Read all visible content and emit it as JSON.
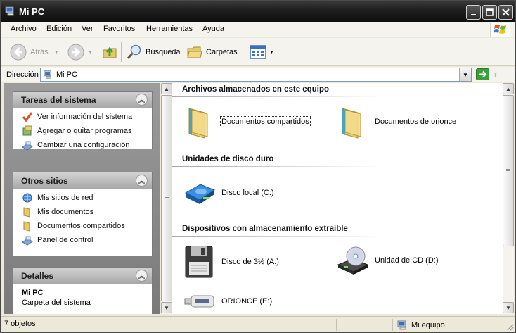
{
  "window": {
    "title": "Mi PC"
  },
  "menu": [
    "Archivo",
    "Edición",
    "Ver",
    "Favoritos",
    "Herramientas",
    "Ayuda"
  ],
  "toolbar": {
    "back": "Atrás",
    "search": "Búsqueda",
    "folders": "Carpetas"
  },
  "address": {
    "label": "Dirección",
    "value": "Mi PC",
    "go": "Ir"
  },
  "sidebar": {
    "tasks_title": "Tareas del sistema",
    "tasks": [
      {
        "label": "Ver información del sistema",
        "icon": "checkmark-icon"
      },
      {
        "label": "Agregar o quitar programas",
        "icon": "install-programs-icon"
      },
      {
        "label": "Cambiar una configuración",
        "icon": "control-panel-icon"
      }
    ],
    "places_title": "Otros sitios",
    "places": [
      {
        "label": "Mis sitios de red",
        "icon": "network-icon"
      },
      {
        "label": "Mis documentos",
        "icon": "folder-icon"
      },
      {
        "label": "Documentos compartidos",
        "icon": "folder-icon"
      },
      {
        "label": "Panel de control",
        "icon": "control-panel-icon"
      }
    ],
    "details_title": "Detalles",
    "details_name": "Mi PC",
    "details_desc": "Carpeta del sistema"
  },
  "content": {
    "groups": [
      {
        "title": "Archivos almacenados en este equipo"
      },
      {
        "title": "Unidades de disco duro"
      },
      {
        "title": "Dispositivos con almacenamiento extraíble"
      }
    ],
    "items": [
      {
        "label": "Documentos compartidos",
        "icon": "folder-icon"
      },
      {
        "label": "Documentos de orionce",
        "icon": "folder-icon"
      },
      {
        "label": "Disco local (C:)",
        "icon": "hard-drive-icon"
      },
      {
        "label": "Disco de 3½ (A:)",
        "icon": "floppy-icon"
      },
      {
        "label": "Unidad de CD (D:)",
        "icon": "cd-drive-icon"
      },
      {
        "label": "ORIONCE (E:)",
        "icon": "usb-drive-icon"
      }
    ]
  },
  "status": {
    "count": "7 objetos",
    "zone": "Mi equipo"
  }
}
